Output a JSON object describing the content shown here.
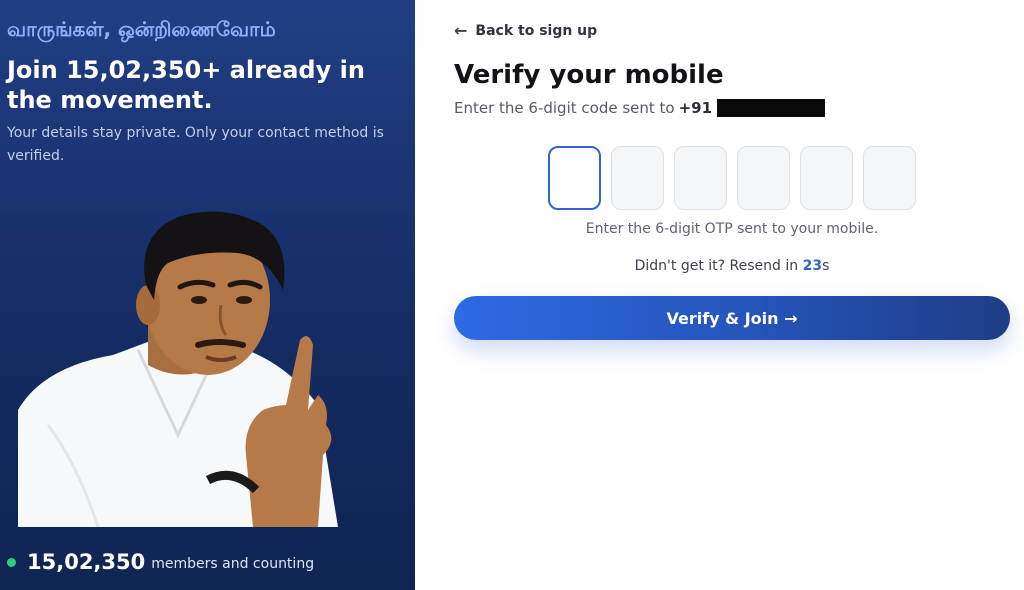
{
  "hero": {
    "tamil_greeting": "வாருங்கள், ஒன்றிணைவோம்",
    "headline": "Join 15,02,350+ already in the movement.",
    "subtext": "Your details stay private. Only your contact method is verified.",
    "member_count": "15,02,350",
    "member_label": "members and counting",
    "status_color": "#2fd07a"
  },
  "form": {
    "back_label": "Back to sign up",
    "title": "Verify your mobile",
    "subtitle": "Enter the 6-digit code sent to",
    "country_code": "+91",
    "otp_hint": "Enter the 6-digit OTP sent to your mobile.",
    "resend_prefix": "Didn't get it?  Resend in ",
    "resend_seconds": "23",
    "resend_unit": "s",
    "verify_label": "Verify & Join →",
    "accent_color": "#2f63d6"
  }
}
